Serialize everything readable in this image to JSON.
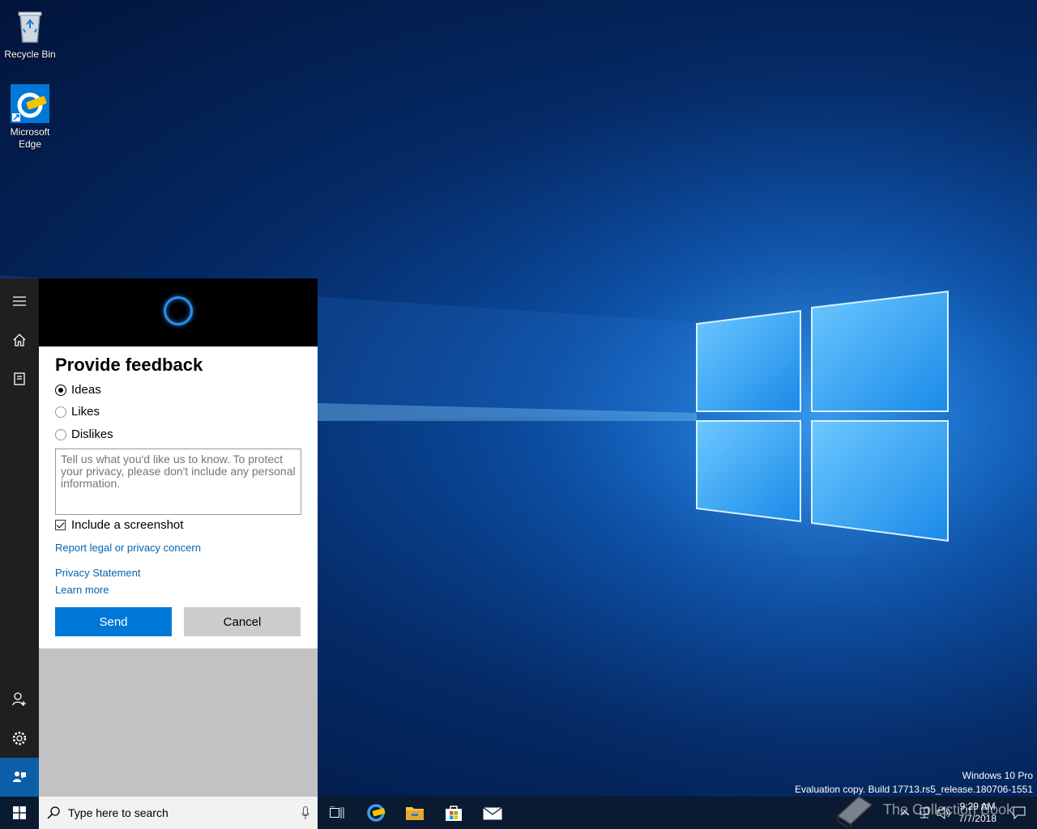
{
  "desktop": {
    "icons": [
      {
        "label": "Recycle Bin",
        "icon": "recycle-bin-icon"
      },
      {
        "label": "Microsoft Edge",
        "icon": "edge-beta-icon"
      }
    ],
    "build_info": {
      "line1": "Windows 10 Pro",
      "line2": "Evaluation copy. Build 17713.rs5_release.180706-1551"
    }
  },
  "cortana": {
    "rail_icons": [
      "hamburger-menu-icon",
      "home-icon",
      "notebook-icon",
      "add-user-icon",
      "settings-icon",
      "feedback-icon"
    ],
    "feedback": {
      "title": "Provide feedback",
      "options": [
        {
          "label": "Ideas",
          "selected": true
        },
        {
          "label": "Likes",
          "selected": false
        },
        {
          "label": "Dislikes",
          "selected": false
        }
      ],
      "textarea_placeholder": "Tell us what you'd like us to know. To protect your privacy, please don't include any personal information.",
      "textarea_value": "",
      "include_screenshot_label": "Include a screenshot",
      "include_screenshot_checked": true,
      "report_link": "Report legal or privacy concern",
      "privacy_link": "Privacy Statement",
      "learn_more_link": "Learn more",
      "send_label": "Send",
      "cancel_label": "Cancel"
    }
  },
  "taskbar": {
    "search_placeholder": "Type here to search",
    "apps": [
      "task-view-icon",
      "edge-beta-icon",
      "file-explorer-icon",
      "store-icon",
      "mail-icon"
    ],
    "clock_time": "9:29 AM",
    "clock_date": "7/7/2018",
    "watermark": "The Collection Book"
  },
  "colors": {
    "accent": "#0078d7",
    "link": "#0063b1",
    "taskbar": "#0a1a30"
  }
}
